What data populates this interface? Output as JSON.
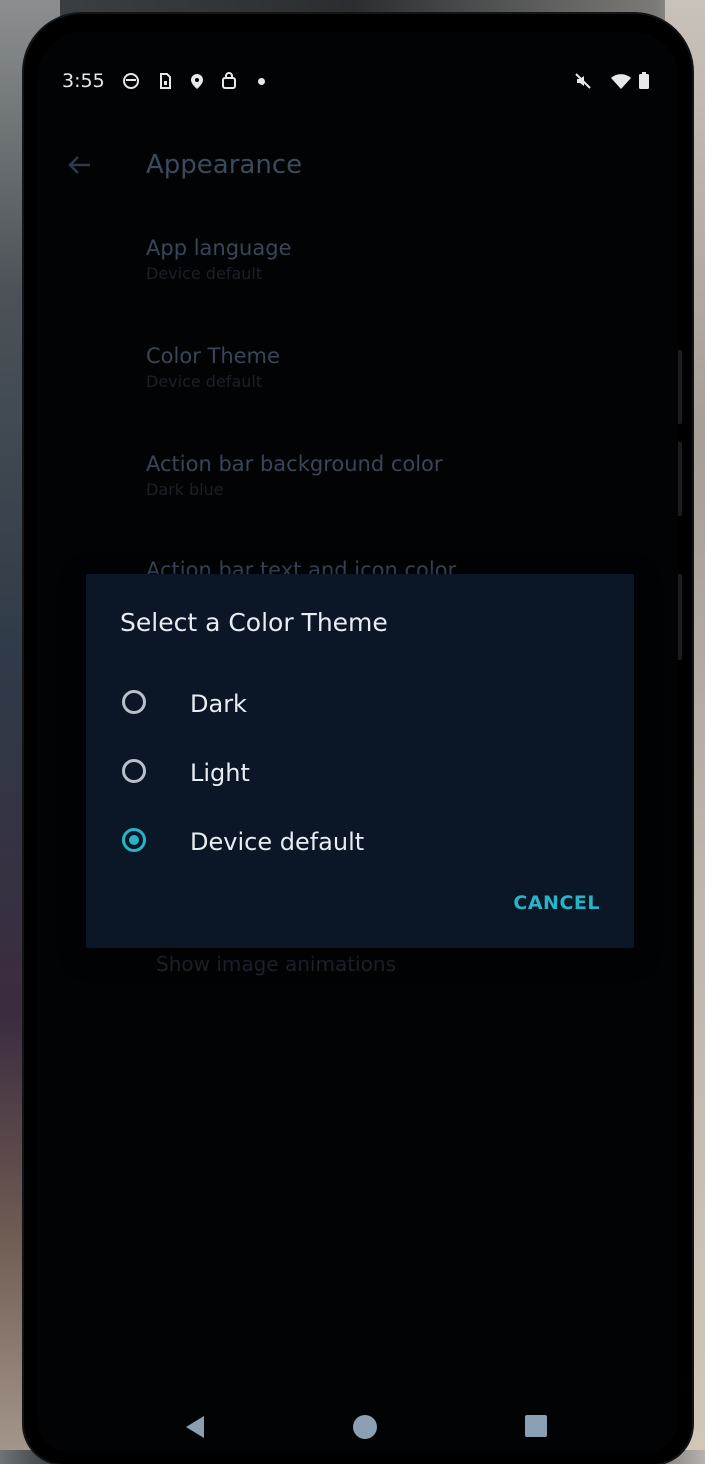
{
  "status_bar": {
    "time": "3:55",
    "left_icons": [
      "circle-notification-icon",
      "sim-icon",
      "location-icon",
      "shopping-bag-icon"
    ],
    "right_icons": [
      "mute-icon",
      "wifi-icon",
      "battery-icon"
    ]
  },
  "page": {
    "title": "Appearance",
    "prefs": [
      {
        "title": "App language",
        "summary": "Device default"
      },
      {
        "title": "Color Theme",
        "summary": "Device default"
      },
      {
        "title": "Action bar background color",
        "summary": "Dark blue"
      },
      {
        "title": "Action bar text and icon color",
        "summary": ""
      }
    ],
    "below_dialog_pref": "Show image animations"
  },
  "dialog": {
    "title": "Select a Color Theme",
    "options": [
      {
        "label": "Dark",
        "selected": false
      },
      {
        "label": "Light",
        "selected": false
      },
      {
        "label": "Device default",
        "selected": true
      }
    ],
    "cancel_label": "CANCEL"
  },
  "colors": {
    "accent": "#26b5c8",
    "dialog_bg": "#0b1626"
  },
  "nav_bar": [
    "back-icon",
    "home-icon",
    "recents-icon"
  ]
}
